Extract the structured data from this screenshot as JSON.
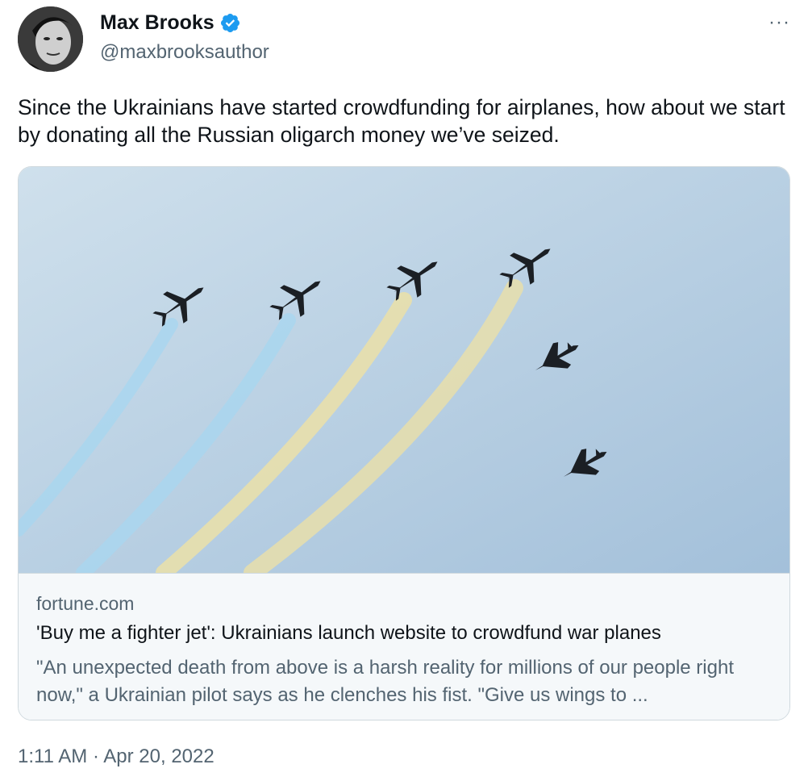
{
  "author": {
    "name": "Max Brooks",
    "handle": "@maxbrooksauthor",
    "verified": true,
    "avatar_icon": "author-portrait"
  },
  "menu_icon": "more-horizontal-icon",
  "menu_label": "···",
  "tweet": {
    "text": "Since the Ukrainians have started crowdfunding for airplanes, how about we start by donating all the Russian oligarch money we’ve seized."
  },
  "card": {
    "image_description_icon": "fighter-jets-formation-image",
    "domain": "fortune.com",
    "title": "'Buy me a fighter jet': Ukrainians launch website to crowdfund war planes",
    "description": "\"An unexpected death from above is a harsh reality for millions of our people right now,\" a Ukrainian pilot says as he clenches his fist. \"Give us wings to ..."
  },
  "timestamp": "1:11 AM · Apr 20, 2022",
  "colors": {
    "verified_blue": "#1d9bf0",
    "secondary_text": "#536471",
    "border": "#cfd9de",
    "sky_top": "#c9dbe8",
    "sky_bottom": "#a8c4dc",
    "smoke_blue": "#9fd2ef",
    "smoke_yellow": "#e8dfa8"
  }
}
